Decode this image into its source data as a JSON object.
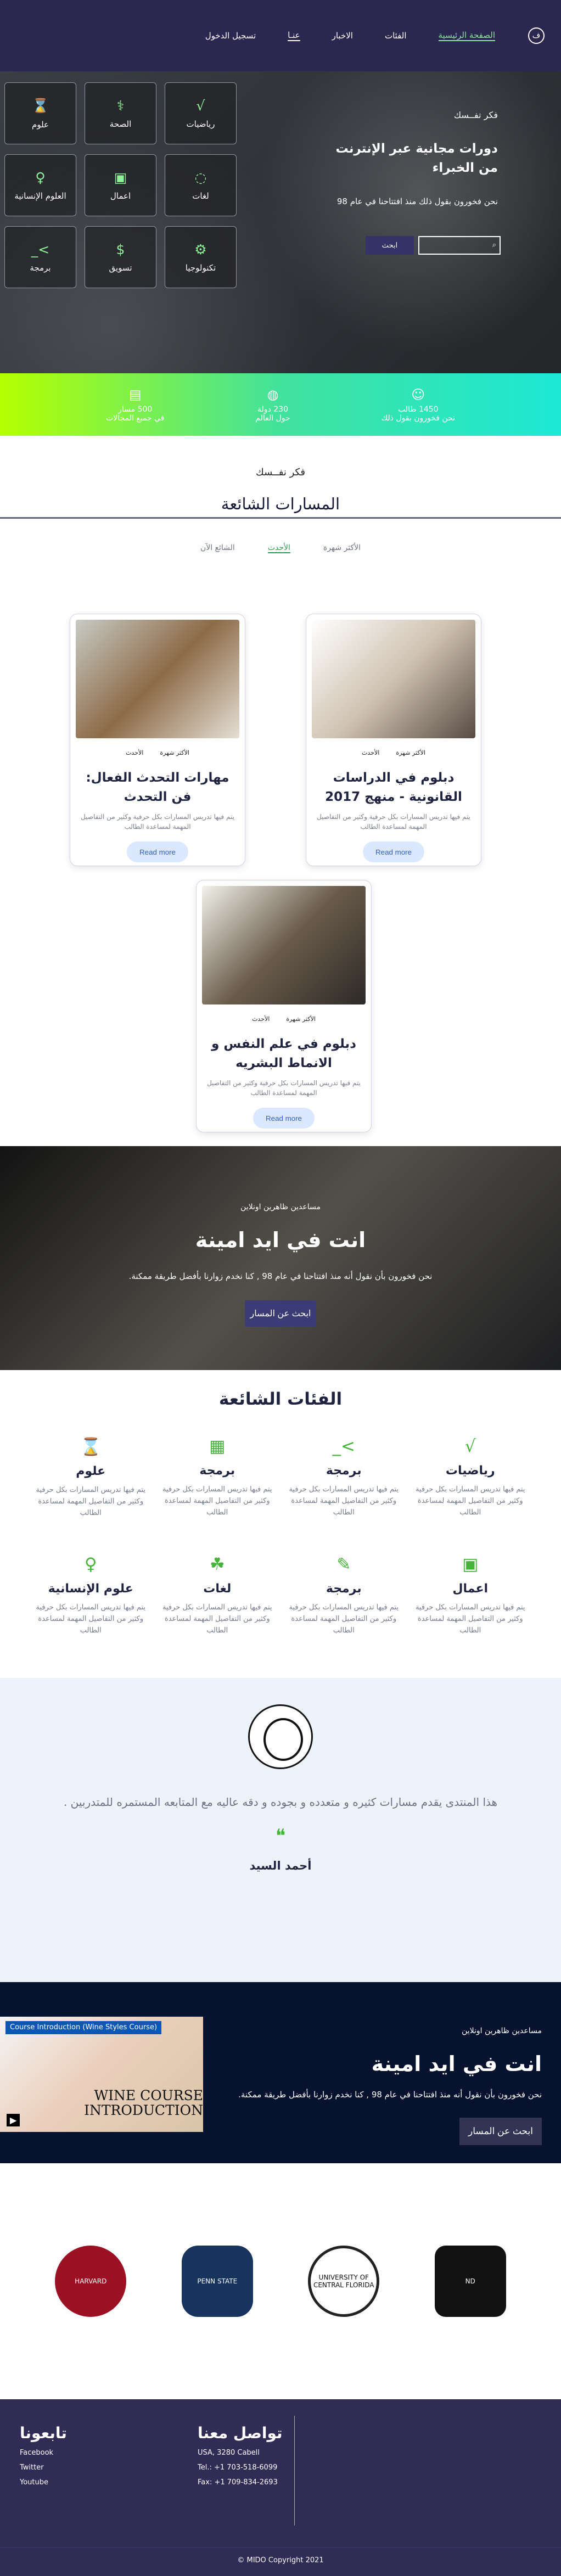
{
  "nav": {
    "logo": "ف",
    "items": [
      "الصفحة الرئيسية",
      "الفئات",
      "الاخبار",
      "عنـا",
      "تسجيل الدخول"
    ]
  },
  "hero": {
    "small": "فكر تفــسك",
    "title": "دورات مجانية عبر الإنترنت من الخبراء",
    "subtitle": "نحن فخورون بقول ذلك منذ افتتاحنا في عام 98",
    "search_button": "ابحث",
    "tiles": [
      {
        "label": "رياضيات",
        "icon": "math-icon"
      },
      {
        "label": "الصحة",
        "icon": "health-icon"
      },
      {
        "label": "علوم",
        "icon": "science-icon"
      },
      {
        "label": "لغات",
        "icon": "languages-icon"
      },
      {
        "label": "اعمال",
        "icon": "business-icon"
      },
      {
        "label": "العلوم الإنسانية",
        "icon": "humanities-icon"
      },
      {
        "label": "تكنولوجيا",
        "icon": "technology-icon"
      },
      {
        "label": "تسويق",
        "icon": "marketing-icon"
      },
      {
        "label": "برمجة",
        "icon": "programming-icon"
      }
    ]
  },
  "stats": [
    {
      "value": "1450 طالب",
      "label": "نحن فخورون بقول ذلك"
    },
    {
      "value": "230 دولة",
      "label": "حول العالم"
    },
    {
      "value": "500 مسار",
      "label": "في جميع المجالات"
    }
  ],
  "courses_section": {
    "subtitle": "فكر نفــسك",
    "title": "المسارات الشائعة",
    "tabs": [
      "الأكثر شهرة",
      "الأحدث",
      "الشائع الآن"
    ]
  },
  "courses": [
    {
      "title": "دبلوم في الدراسات القانونية - منهج 2017",
      "meta": [
        "الأكثر شهرة",
        "الأحدث"
      ],
      "desc": "يتم فيها تدريس المسارات بكل حرفية وكثير من التفاصيل المهمة لمساعدة الطالب",
      "button": "Read more"
    },
    {
      "title": "مهارات التحدث الفعال: فن التحدث",
      "meta": [
        "الأكثر شهرة",
        "الأحدث"
      ],
      "desc": "يتم فيها تدريس المسارات بكل حرفية وكثير من التفاصيل المهمة لمساعدة الطالب",
      "button": "Read more"
    },
    {
      "title": "دبلوم في علم النفس و الانماط البشريه",
      "meta": [
        "الأكثر شهرة",
        "الأحدث"
      ],
      "desc": "يتم فيها تدريس المسارات بكل حرفية وكثير من التفاصيل المهمة لمساعدة الطالب",
      "button": "Read more"
    }
  ],
  "cta1": {
    "small": "مساعدين ظاهرين اونلاين",
    "title": "انت في ايد امينة",
    "text": "نحن فخورون بأن نقول أنه منذ افتتاحنا في عام 98 , كنا نخدم زوارنا بأفضل طريقة ممكنة.",
    "button": "ابحث عن المسار"
  },
  "popular": {
    "title": "الفئات الشائعة",
    "items": [
      {
        "title": "رياضيات",
        "desc": "يتم فيها تدريس المسارات بكل حرفية وكثير من التفاصيل المهمة لمساعدة الطالب"
      },
      {
        "title": "برمجة",
        "desc": "يتم فيها تدريس المسارات بكل حرفية وكثير من التفاصيل المهمة لمساعدة الطالب"
      },
      {
        "title": "برمجة",
        "desc": "يتم فيها تدريس المسارات بكل حرفية وكثير من التفاصيل المهمة لمساعدة الطالب"
      },
      {
        "title": "علوم",
        "desc": "يتم فيها تدريس المسارات بكل حرفية وكثير من التفاصيل المهمة لمساعدة الطالب"
      },
      {
        "title": "اعمال",
        "desc": "يتم فيها تدريس المسارات بكل حرفية وكثير من التفاصيل المهمة لمساعدة الطالب"
      },
      {
        "title": "برمجة",
        "desc": "يتم فيها تدريس المسارات بكل حرفية وكثير من التفاصيل المهمة لمساعدة الطالب"
      },
      {
        "title": "لغات",
        "desc": "يتم فيها تدريس المسارات بكل حرفية وكثير من التفاصيل المهمة لمساعدة الطالب"
      },
      {
        "title": "علوم الإنسانية",
        "desc": "يتم فيها تدريس المسارات بكل حرفية وكثير من التفاصيل المهمة لمساعدة الطالب"
      }
    ]
  },
  "testimonial": {
    "text": "هذا المنتدى يقدم مسارات كثيره و متعدده و بجوده و دقه عاليه مع المتابعه المستمره للمتدربين .",
    "author": "أحمد السيد"
  },
  "cta2": {
    "small": "مساعدين ظاهرين اونلاين",
    "title": "انت في ايد امينة",
    "text": "نحن فخورون بأن نقول أنه منذ افتتاحنا في عام 98 , كنا نخدم زوارنا بأفضل طريقة ممكنة.",
    "button": "ابحث عن المسار",
    "video_title": "Course Introduction (Wine Styles Course)",
    "video_overlay": "WINE COURSE INTRODUCTION"
  },
  "logos": [
    "ND",
    "UNIVERSITY OF CENTRAL FLORIDA",
    "PENN STATE",
    "HARVARD"
  ],
  "footer": {
    "follow_title": "تابعونا",
    "social": [
      "Facebook",
      "Twitter",
      "Youtube"
    ],
    "contact_title": "تواصل معنا",
    "address": "USA, 3280 Cabell",
    "tel": "Tel.: +1 703-518-6099",
    "fax": "Fax: +1 709-834-2693",
    "copyright": "MIDO Copyright 2021 ©"
  }
}
